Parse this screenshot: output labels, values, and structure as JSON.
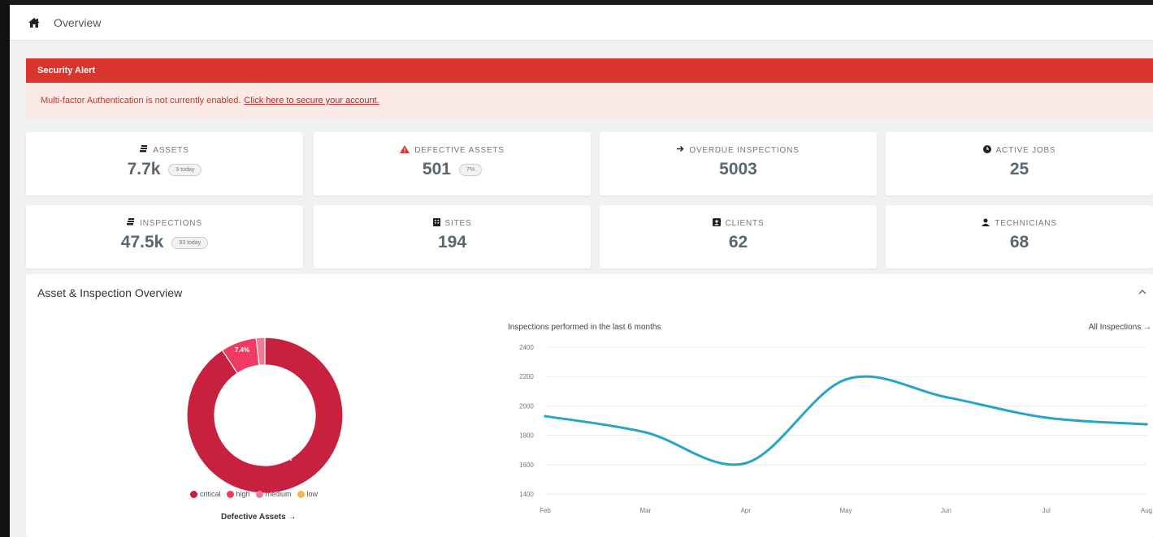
{
  "breadcrumb": {
    "icon": "home-icon",
    "label": "Overview"
  },
  "alert": {
    "title": "Security Alert",
    "message": "Multi-factor Authentication is not currently enabled.",
    "link_text": "Click here to secure your account."
  },
  "stats": [
    {
      "label": "ASSETS",
      "value": "7.7k",
      "pill": "9 today",
      "icon": "stack-icon"
    },
    {
      "label": "DEFECTIVE ASSETS",
      "value": "501",
      "pill": "7%",
      "icon": "warning-icon"
    },
    {
      "label": "OVERDUE INSPECTIONS",
      "value": "5003",
      "icon": "arrow-right-icon"
    },
    {
      "label": "ACTIVE JOBS",
      "value": "25",
      "icon": "clock-icon"
    },
    {
      "label": "INSPECTIONS",
      "value": "47.5k",
      "pill": "93 today",
      "icon": "stack-icon"
    },
    {
      "label": "SITES",
      "value": "194",
      "icon": "building-icon"
    },
    {
      "label": "CLIENTS",
      "value": "62",
      "icon": "contact-card-icon"
    },
    {
      "label": "TECHNICIANS",
      "value": "68",
      "icon": "user-icon"
    }
  ],
  "panel": {
    "title": "Asset & Inspection Overview",
    "collapse_icon": "chevron-up-icon",
    "donut_link": "Defective Assets →",
    "chart_title": "Inspections performed in the last 6 months",
    "chart_link": "All Inspections →"
  },
  "colors": {
    "critical": "#c8203f",
    "high": "#f03a64",
    "medium": "#f27a95",
    "low": "#f5b555",
    "line": "#2aa3c7",
    "alert": "#d9352c"
  },
  "chart_data": [
    {
      "type": "pie",
      "labels": [
        "critical",
        "high",
        "medium",
        "low"
      ],
      "values": [
        90.8,
        7.4,
        1.8,
        0.0
      ],
      "data_labels": [
        "90.8%",
        "7.4%"
      ],
      "legend_position": "bottom"
    },
    {
      "type": "line",
      "x": [
        "Feb",
        "Mar",
        "Apr",
        "May",
        "Jun",
        "Jul",
        "Aug"
      ],
      "series": [
        {
          "values": [
            1930,
            1820,
            1610,
            2180,
            2060,
            1920,
            1875
          ]
        }
      ],
      "ylim": [
        1400,
        2400
      ],
      "yticks": [
        1400,
        1600,
        1800,
        2000,
        2200,
        2400
      ],
      "grid": true
    }
  ]
}
